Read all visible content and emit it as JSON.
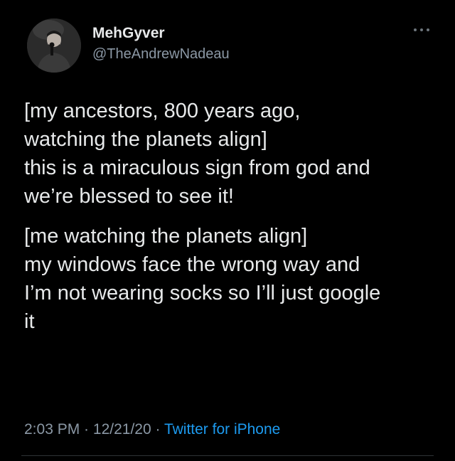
{
  "colors": {
    "background": "#000000",
    "text": "#e7e9ea",
    "secondary": "#8b98a5",
    "link": "#1d9bf0"
  },
  "author": {
    "display_name": "MehGyver",
    "handle": "@TheAndrewNadeau"
  },
  "icons": {
    "more": "more-horizontal-icon"
  },
  "tweet": {
    "paragraphs": [
      {
        "lines": [
          "[my ancestors, 800 years ago,",
          "watching the planets align]",
          "this is a miraculous sign from god and",
          "we’re blessed to see it!"
        ]
      },
      {
        "lines": [
          "[me watching the planets align]",
          "my windows face the wrong way and",
          "I’m not wearing socks so I’ll just google",
          "it"
        ]
      }
    ]
  },
  "meta": {
    "time": "2:03 PM",
    "separator": " · ",
    "date": "12/21/20",
    "source": "Twitter for iPhone"
  }
}
